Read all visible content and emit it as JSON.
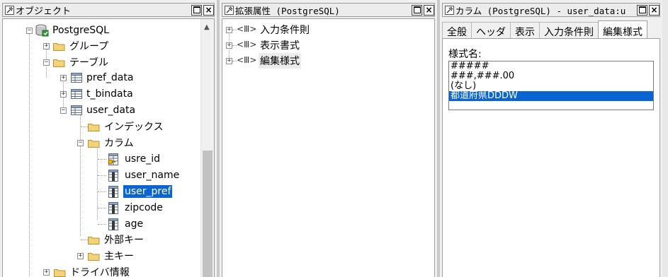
{
  "left_panel": {
    "title": "オブジェクト",
    "tree": [
      {
        "label": "PostgreSQL",
        "icon": "database-icon"
      },
      {
        "label": "グループ",
        "icon": "folder-icon"
      },
      {
        "label": "テーブル",
        "icon": "folder-icon"
      },
      {
        "label": "pref_data",
        "icon": "table-icon"
      },
      {
        "label": "t_bindata",
        "icon": "table-icon"
      },
      {
        "label": "user_data",
        "icon": "table-icon"
      },
      {
        "label": "インデックス",
        "icon": "folder-icon"
      },
      {
        "label": "カラム",
        "icon": "folder-icon"
      },
      {
        "label": "usre_id",
        "icon": "key-column-icon"
      },
      {
        "label": "user_name",
        "icon": "column-icon"
      },
      {
        "label": "user_pref",
        "icon": "column-icon",
        "selected": true
      },
      {
        "label": "zipcode",
        "icon": "column-icon"
      },
      {
        "label": "age",
        "icon": "column-icon"
      },
      {
        "label": "外部キー",
        "icon": "folder-icon"
      },
      {
        "label": "主キー",
        "icon": "folder-icon"
      },
      {
        "label": "ドライバ情報",
        "icon": "folder-icon"
      }
    ]
  },
  "middle_panel": {
    "title": "拡張属性 (PostgreSQL)",
    "items": [
      {
        "label": "入力条件則"
      },
      {
        "label": "表示書式"
      },
      {
        "label": "編集様式"
      }
    ]
  },
  "right_panel": {
    "title": "カラム (PostgreSQL) - user_data:u",
    "tabs": [
      "全般",
      "ヘッダ",
      "表示",
      "入力条件則",
      "編集様式"
    ],
    "active_tab": "編集様式",
    "format_label": "様式名:",
    "formats": [
      "#####",
      "###,###.00",
      "(なし)",
      "都道府県DDDW"
    ],
    "selected_format": "都道府県DDDW"
  },
  "colors": {
    "selection": "#0a64d2",
    "panel_bg": "#f0f0f0"
  }
}
